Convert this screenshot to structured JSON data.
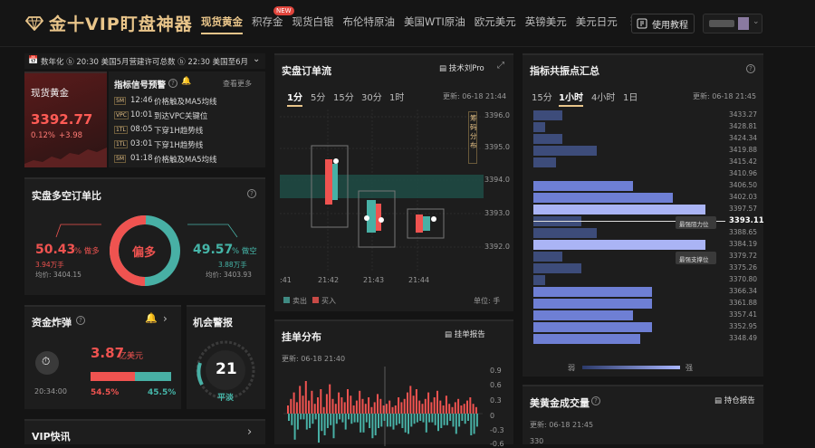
{
  "header": {
    "logo_text": "金十VIP盯盘神器",
    "nav": [
      {
        "label": "现货黄金",
        "active": true
      },
      {
        "label": "积存金",
        "badge": "NEW"
      },
      {
        "label": "现货白银"
      },
      {
        "label": "布伦特原油"
      },
      {
        "label": "美国WTI原油"
      },
      {
        "label": "欧元美元"
      },
      {
        "label": "英镑美元"
      },
      {
        "label": "美元日元"
      }
    ],
    "tutorial_label": "使用教程"
  },
  "ticker": {
    "text": "数年化 ⓑ 20:30 美国5月营建许可总数 ⓑ 22:30 美国至6月"
  },
  "quote": {
    "name": "现货黄金",
    "price": "3392.77",
    "change_pct": "0.12%",
    "change": "+3.98"
  },
  "signals": {
    "title": "指标信号预警",
    "more": "查看更多",
    "items": [
      {
        "tag": "5M",
        "time": "12:46",
        "text": "价格触及MA5均线"
      },
      {
        "tag": "VPC",
        "time": "10:01",
        "text": "到达VPC关键位"
      },
      {
        "tag": "1TL",
        "time": "08:05",
        "text": "下穿1H趋势线"
      },
      {
        "tag": "1TL",
        "time": "03:01",
        "text": "下穿1H趋势线"
      },
      {
        "tag": "5M",
        "time": "01:18",
        "text": "价格触及MA5均线"
      }
    ]
  },
  "long_short": {
    "title": "实盘多空订单比",
    "center": "偏多",
    "long": {
      "pct": "50.43",
      "suffix": "% 做多",
      "amount": "3.94万手",
      "avg": "均价: 3404.15"
    },
    "short": {
      "pct": "49.57",
      "suffix": "% 做空",
      "amount": "3.88万手",
      "avg": "均价: 3403.93"
    }
  },
  "bomb": {
    "title": "资金炸弹",
    "time": "20:34:00",
    "amount": "3.87",
    "unit": "亿美元",
    "buy_pct": "54.5%",
    "sell_pct": "45.5%",
    "buy_ratio": 0.545
  },
  "alert": {
    "title": "机会警报",
    "value": "21",
    "label": "平淡"
  },
  "vip_news": {
    "title": "VIP快讯"
  },
  "order_flow": {
    "title": "实盘订单流",
    "tool": "技术刘Pro",
    "tabs": [
      {
        "label": "1分",
        "active": true
      },
      {
        "label": "5分"
      },
      {
        "label": "15分"
      },
      {
        "label": "30分"
      },
      {
        "label": "1时"
      }
    ],
    "update": "更新: 06-18 21:44",
    "y_ticks": [
      "3396.0",
      "3395.0",
      "3394.0",
      "3393.0",
      "3392.0"
    ],
    "x_ticks": [
      ":41",
      "21:42",
      "21:43",
      "21:44"
    ],
    "side_label": "筹码分布",
    "legend_sell": "卖出",
    "legend_buy": "买入",
    "unit": "单位: 手"
  },
  "order_dist": {
    "title": "挂单分布",
    "tool": "挂单报告",
    "update": "更新: 06-18 21:40",
    "y_ticks": [
      "0.9",
      "0.6",
      "0.3",
      "0",
      "-0.3",
      "-0.6"
    ]
  },
  "levels": {
    "title": "指标共振点汇总",
    "tabs": [
      {
        "label": "15分"
      },
      {
        "label": "1小时",
        "active": true
      },
      {
        "label": "4小时"
      },
      {
        "label": "1日"
      }
    ],
    "update": "更新: 06-18 21:45",
    "prices": [
      "3433.27",
      "3428.81",
      "3424.34",
      "3419.88",
      "3415.42",
      "3410.96",
      "3406.50",
      "3402.03",
      "3397.57",
      "3393.11",
      "3388.65",
      "3384.19",
      "3379.72",
      "3375.26",
      "3370.80",
      "3366.34",
      "3361.88",
      "3357.41",
      "3352.95",
      "3348.49"
    ],
    "strengths": [
      0.17,
      0.07,
      0.17,
      0.37,
      0.13,
      0,
      0.58,
      0.81,
      1.0,
      0.28,
      0.37,
      1.0,
      0.17,
      0.28,
      0.07,
      0.69,
      0.69,
      0.58,
      0.69,
      0.62
    ],
    "current": "3393.11",
    "resistance": "最强阻力位",
    "support": "最强支撑位",
    "weak": "弱",
    "strong": "强"
  },
  "gold_volume": {
    "title": "美黄金成交量",
    "tool": "持仓报告",
    "update": "更新: 06-18 21:45",
    "y_top": "330"
  }
}
